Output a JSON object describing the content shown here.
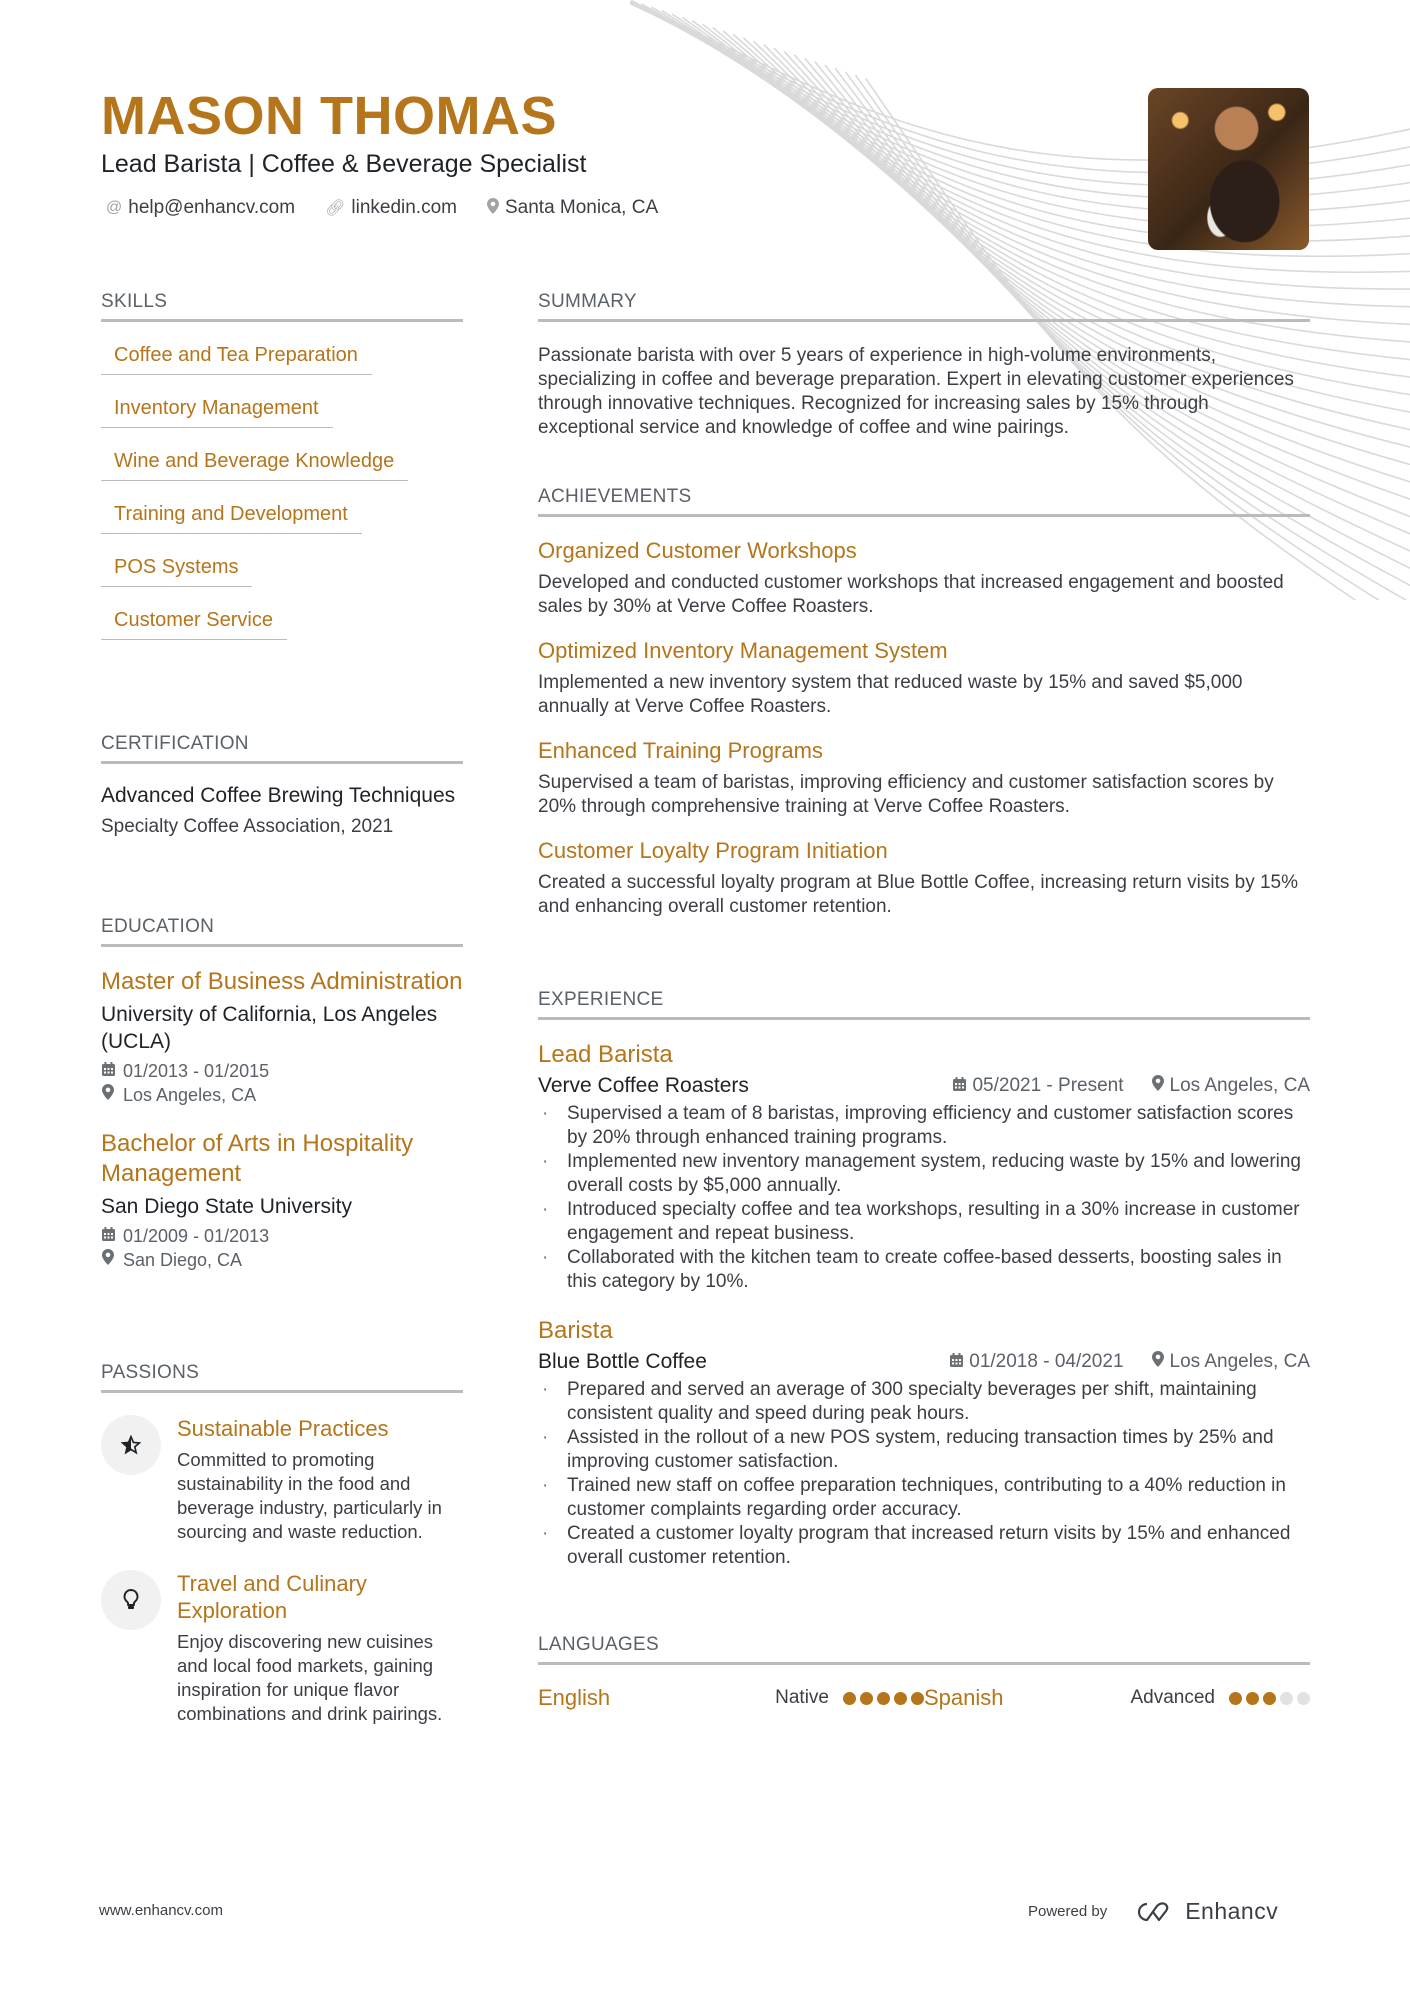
{
  "header": {
    "name": "MASON THOMAS",
    "title": "Lead Barista | Coffee & Beverage Specialist",
    "contacts": [
      {
        "icon": "at-icon",
        "text": "help@enhancv.com"
      },
      {
        "icon": "link-icon",
        "text": "linkedin.com"
      },
      {
        "icon": "location-pin-icon",
        "text": "Santa Monica, CA"
      }
    ],
    "photo_alt": "Barista pouring latte art"
  },
  "skills": {
    "heading": "SKILLS",
    "items": [
      "Coffee and Tea Preparation",
      "Inventory Management",
      "Wine and Beverage Knowledge",
      "Training and Development",
      "POS Systems",
      "Customer Service"
    ]
  },
  "certification": {
    "heading": "CERTIFICATION",
    "title": "Advanced Coffee Brewing Techniques",
    "issuer": "Specialty Coffee Association, 2021"
  },
  "education": {
    "heading": "EDUCATION",
    "items": [
      {
        "degree": "Master of Business Administration",
        "school": "University of California, Los Angeles (UCLA)",
        "dates": "01/2013 - 01/2015",
        "location": "Los Angeles, CA"
      },
      {
        "degree": "Bachelor of Arts in Hospitality Management",
        "school": "San Diego State University",
        "dates": "01/2009 - 01/2013",
        "location": "San Diego, CA"
      }
    ]
  },
  "passions": {
    "heading": "PASSIONS",
    "items": [
      {
        "icon": "star-icon",
        "title": "Sustainable Practices",
        "description": "Committed to promoting sustainability in the food and beverage industry, particularly in sourcing and waste reduction."
      },
      {
        "icon": "lightbulb-icon",
        "title": "Travel and Culinary Exploration",
        "description": "Enjoy discovering new cuisines and local food markets, gaining inspiration for unique flavor combinations and drink pairings."
      }
    ]
  },
  "summary": {
    "heading": "SUMMARY",
    "text": "Passionate barista with over 5 years of experience in high-volume environments, specializing in coffee and beverage preparation. Expert in elevating customer experiences through innovative techniques. Recognized for increasing sales by 15% through exceptional service and knowledge of coffee and wine pairings."
  },
  "achievements": {
    "heading": "ACHIEVEMENTS",
    "items": [
      {
        "title": "Organized Customer Workshops",
        "description": "Developed and conducted customer workshops that increased engagement and boosted sales by 30% at Verve Coffee Roasters."
      },
      {
        "title": "Optimized Inventory Management System",
        "description": "Implemented a new inventory system that reduced waste by 15% and saved $5,000 annually at Verve Coffee Roasters."
      },
      {
        "title": "Enhanced Training Programs",
        "description": "Supervised a team of baristas, improving efficiency and customer satisfaction scores by 20% through comprehensive training at Verve Coffee Roasters."
      },
      {
        "title": "Customer Loyalty Program Initiation",
        "description": "Created a successful loyalty program at Blue Bottle Coffee, increasing return visits by 15% and enhancing overall customer retention."
      }
    ]
  },
  "experience": {
    "heading": "EXPERIENCE",
    "jobs": [
      {
        "title": "Lead Barista",
        "company": "Verve Coffee Roasters",
        "dates": "05/2021 - Present",
        "location": "Los Angeles, CA",
        "bullets": [
          "Supervised a team of 8 baristas, improving efficiency and customer satisfaction scores by 20% through enhanced training programs.",
          "Implemented new inventory management system, reducing waste by 15% and lowering overall costs by $5,000 annually.",
          "Introduced specialty coffee and tea workshops, resulting in a 30% increase in customer engagement and repeat business.",
          "Collaborated with the kitchen team to create coffee-based desserts, boosting sales in this category by 10%."
        ]
      },
      {
        "title": "Barista",
        "company": "Blue Bottle Coffee",
        "dates": "01/2018 - 04/2021",
        "location": "Los Angeles, CA",
        "bullets": [
          "Prepared and served an average of 300 specialty beverages per shift, maintaining consistent quality and speed during peak hours.",
          "Assisted in the rollout of a new POS system, reducing transaction times by 25% and improving customer satisfaction.",
          "Trained new staff on coffee preparation techniques, contributing to a 40% reduction in customer complaints regarding order accuracy.",
          "Created a customer loyalty program that increased return visits by 15% and enhanced overall customer retention."
        ]
      }
    ]
  },
  "languages": {
    "heading": "LANGUAGES",
    "items": [
      {
        "name": "English",
        "level": "Native",
        "rating": 5,
        "max": 5
      },
      {
        "name": "Spanish",
        "level": "Advanced",
        "rating": 3,
        "max": 5
      }
    ]
  },
  "footer": {
    "website": "www.enhancv.com",
    "powered_by": "Powered by",
    "brand": "Enhancv"
  },
  "colors": {
    "accent": "#b5751a",
    "divider": "#b9bcbf",
    "text": "#1f2328",
    "muted": "#5b6169"
  }
}
